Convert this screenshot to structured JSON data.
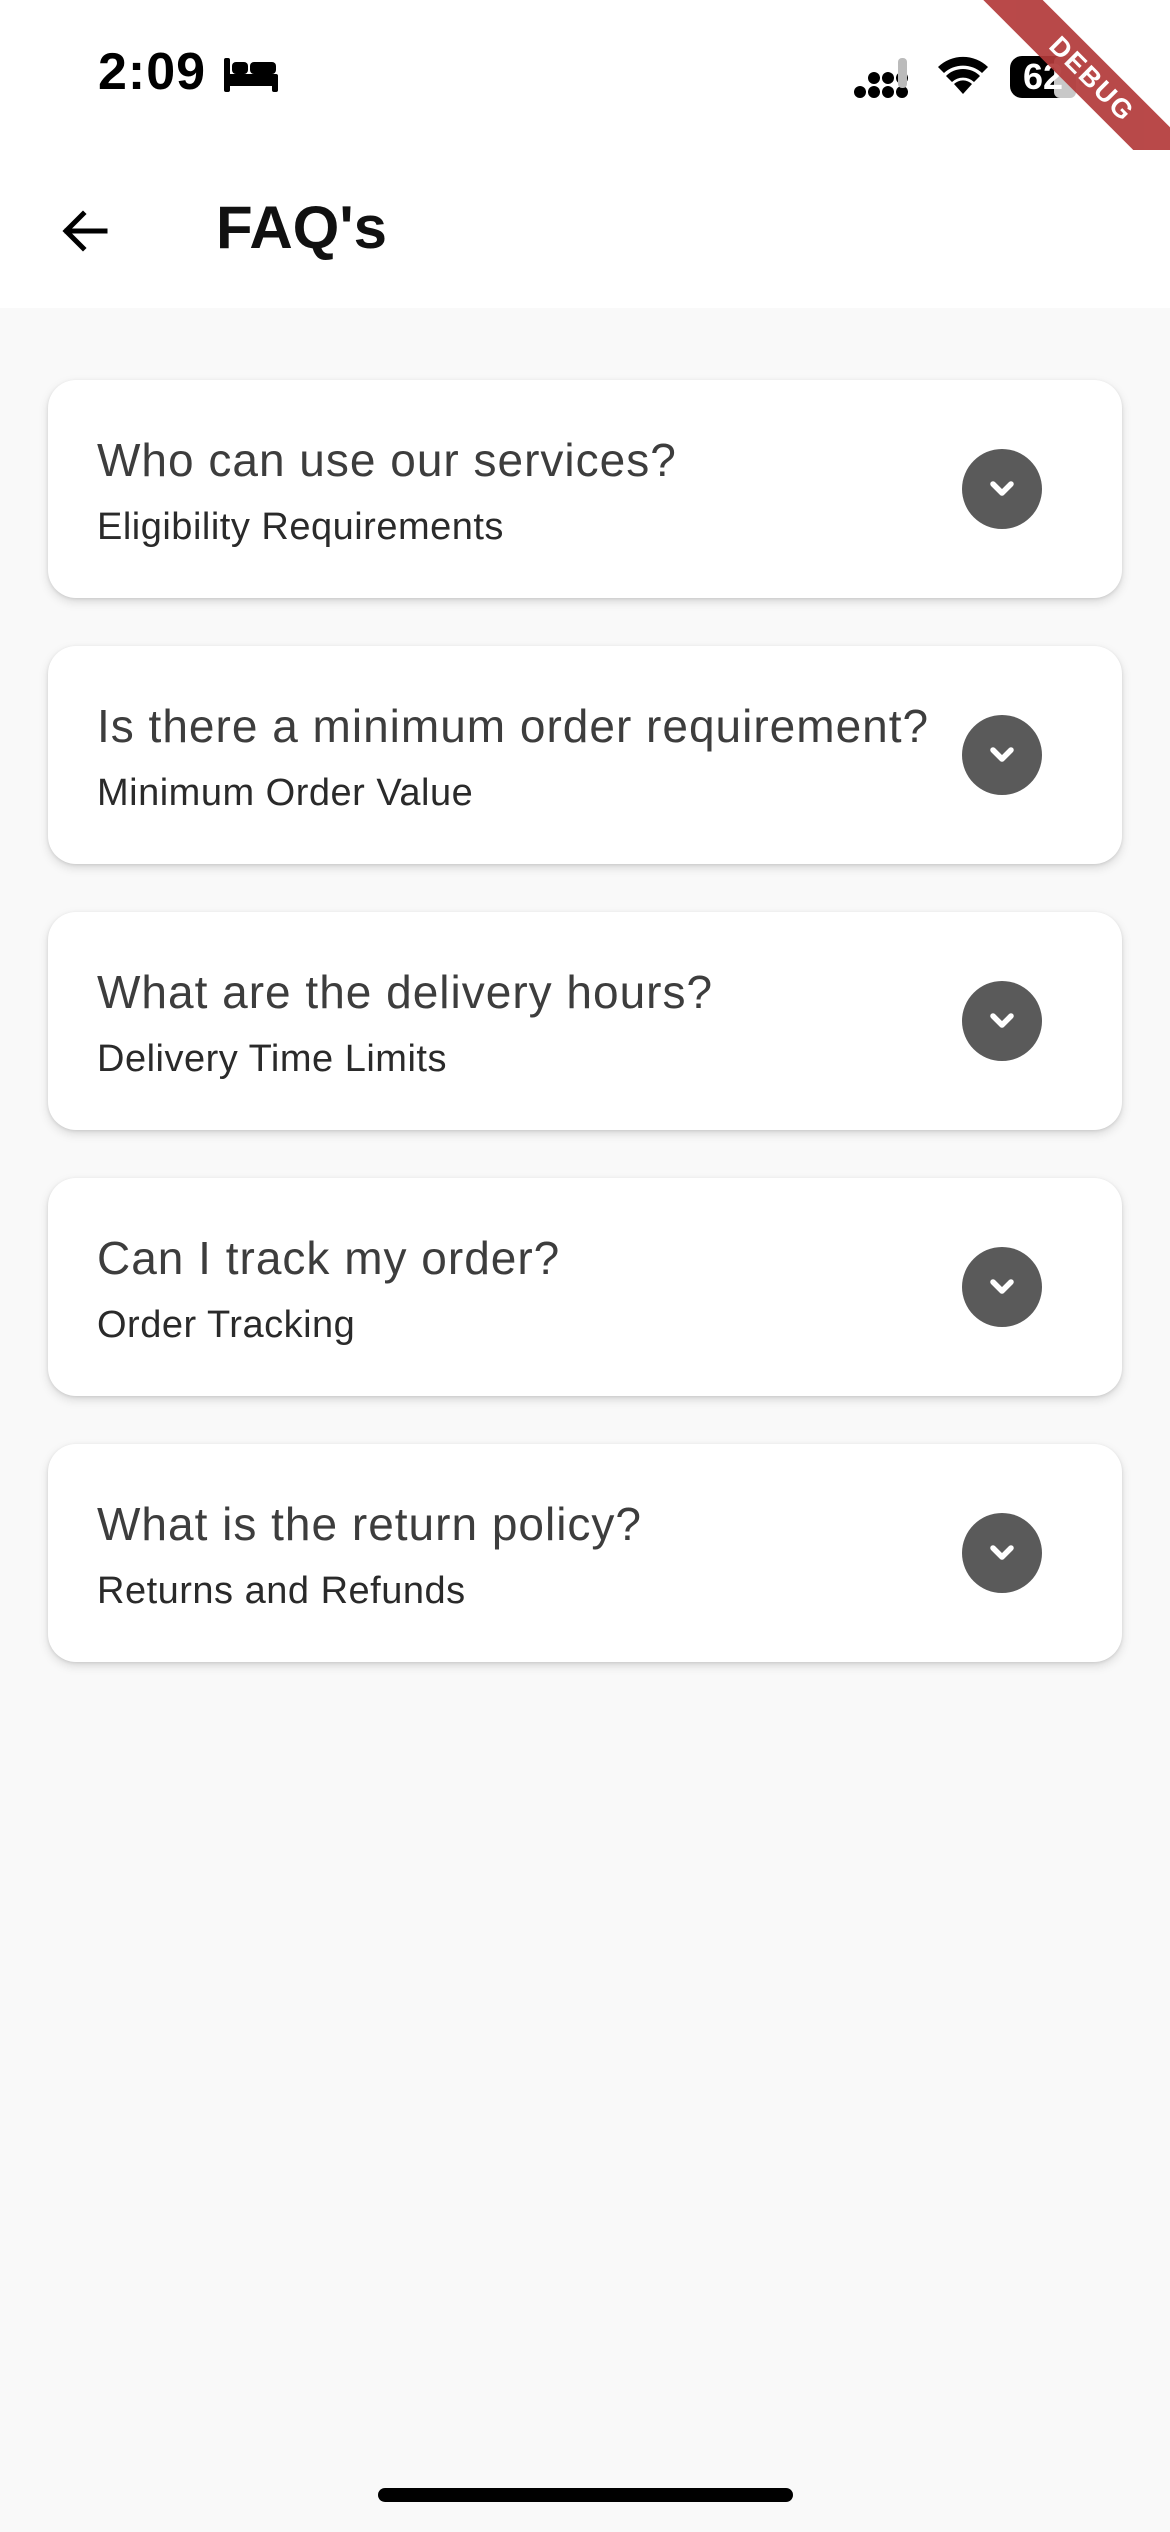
{
  "status_bar": {
    "time": "2:09",
    "battery": "62",
    "icons": [
      "bed-icon",
      "signal-icon",
      "wifi-icon",
      "battery-icon"
    ]
  },
  "debug_banner": "DEBUG",
  "app_bar": {
    "title": "FAQ's",
    "back_icon": "arrow-left-icon"
  },
  "faqs": [
    {
      "question": "Who can use our services?",
      "subtitle": "Eligibility Requirements"
    },
    {
      "question": "Is there a minimum order requirement?",
      "subtitle": "Minimum Order Value"
    },
    {
      "question": "What are the delivery hours?",
      "subtitle": "Delivery Time Limits"
    },
    {
      "question": "Can I track my order?",
      "subtitle": "Order Tracking"
    },
    {
      "question": "What is the return policy?",
      "subtitle": "Returns and Refunds"
    }
  ],
  "colors": {
    "background": "#f9f9f9",
    "card": "#ffffff",
    "expand_icon_bg": "#5a5a5a",
    "debug_ribbon": "#b33a3a"
  }
}
